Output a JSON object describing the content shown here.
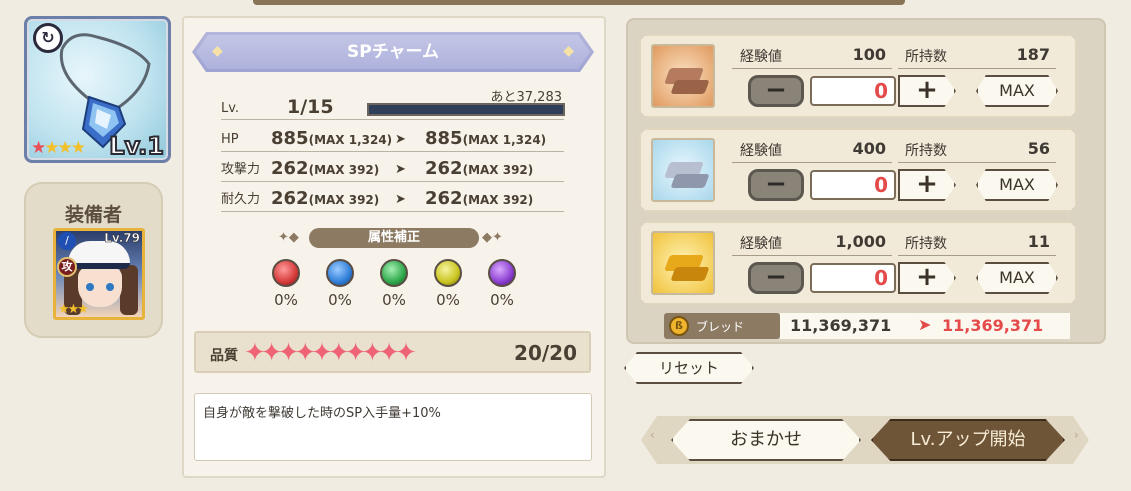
{
  "item": {
    "name": "SPチャーム",
    "level_badge": "Lv.1",
    "rarity_stars": 4,
    "lv_label": "Lv.",
    "lv_value": "1/15",
    "remaining": "あと37,283",
    "exp_progress": 0.0
  },
  "equipper": {
    "label": "装備者",
    "level": "Lv.79",
    "role_badge": "攻",
    "stars": 3
  },
  "stats": [
    {
      "label": "HP",
      "cur": "885",
      "cur_max": "(MAX 1,324)",
      "next": "885",
      "next_max": "(MAX 1,324)"
    },
    {
      "label": "攻撃力",
      "cur": "262",
      "cur_max": "(MAX 392)",
      "next": "262",
      "next_max": "(MAX 392)"
    },
    {
      "label": "耐久力",
      "cur": "262",
      "cur_max": "(MAX 392)",
      "next": "262",
      "next_max": "(MAX 392)"
    }
  ],
  "attribute": {
    "title": "属性補正",
    "values": [
      "0%",
      "0%",
      "0%",
      "0%",
      "0%"
    ],
    "colors": [
      "#d63a3a",
      "#2f7ed8",
      "#2fa84a",
      "#c9c51f",
      "#8b3fd0"
    ]
  },
  "quality": {
    "label": "品質",
    "value": "20/20",
    "stars": 10
  },
  "description": "自身が敵を撃破した時のSP入手量+10%",
  "materials": [
    {
      "exp_label": "経験値",
      "exp": "100",
      "own_label": "所持数",
      "own": "187",
      "qty": "0",
      "max_label": "MAX",
      "tint": "bronze"
    },
    {
      "exp_label": "経験値",
      "exp": "400",
      "own_label": "所持数",
      "own": "56",
      "qty": "0",
      "max_label": "MAX",
      "tint": "silver"
    },
    {
      "exp_label": "経験値",
      "exp": "1,000",
      "own_label": "所持数",
      "own": "11",
      "qty": "0",
      "max_label": "MAX",
      "tint": "gold"
    }
  ],
  "currency": {
    "label": "ブレッド",
    "current": "11,369,371",
    "after": "11,369,371"
  },
  "buttons": {
    "reset": "リセット",
    "auto": "おまかせ",
    "level_up": "Lv.アップ開始"
  },
  "icons": {
    "refresh": "refresh-icon",
    "minus": "minus-icon",
    "plus": "plus-icon",
    "arrow": "arrow-right-icon",
    "coin": "bread-coin-icon"
  }
}
